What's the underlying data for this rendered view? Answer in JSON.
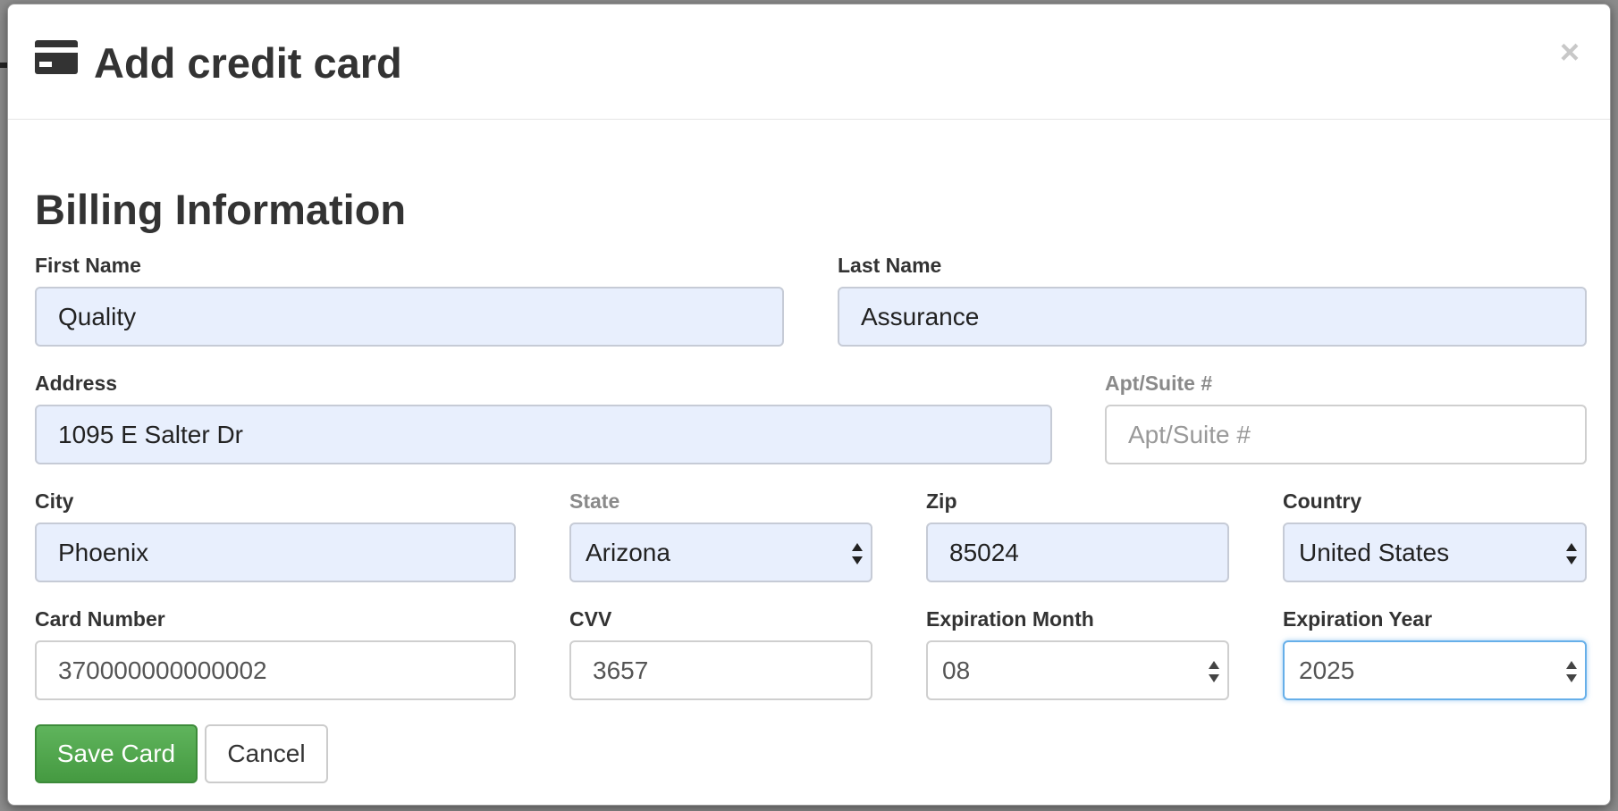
{
  "modal": {
    "title": "Add credit card",
    "close_label": "×",
    "icons": {
      "title_icon": "credit-card-icon",
      "close_icon": "close-icon",
      "select_arrows": "sort-arrows-icon"
    }
  },
  "billing": {
    "section_title": "Billing Information",
    "first_name": {
      "label": "First Name",
      "value": "Quality"
    },
    "last_name": {
      "label": "Last Name",
      "value": "Assurance"
    },
    "address": {
      "label": "Address",
      "value": "1095 E Salter Dr"
    },
    "apt": {
      "label": "Apt/Suite #",
      "value": "",
      "placeholder": "Apt/Suite #"
    },
    "city": {
      "label": "City",
      "value": "Phoenix"
    },
    "state": {
      "label": "State",
      "selected": "Arizona"
    },
    "zip": {
      "label": "Zip",
      "value": "85024"
    },
    "country": {
      "label": "Country",
      "selected": "United States"
    },
    "card_number": {
      "label": "Card Number",
      "value": "370000000000002"
    },
    "cvv": {
      "label": "CVV",
      "value": "3657"
    },
    "exp_month": {
      "label": "Expiration Month",
      "selected": "08"
    },
    "exp_year": {
      "label": "Expiration Year",
      "selected": "2025"
    }
  },
  "actions": {
    "save_label": "Save Card",
    "cancel_label": "Cancel"
  },
  "colors": {
    "autofill_background": "#e8effd",
    "save_button": "#4cae4c",
    "focus_border": "#66afe9",
    "backdrop": "#8c8c8c"
  }
}
